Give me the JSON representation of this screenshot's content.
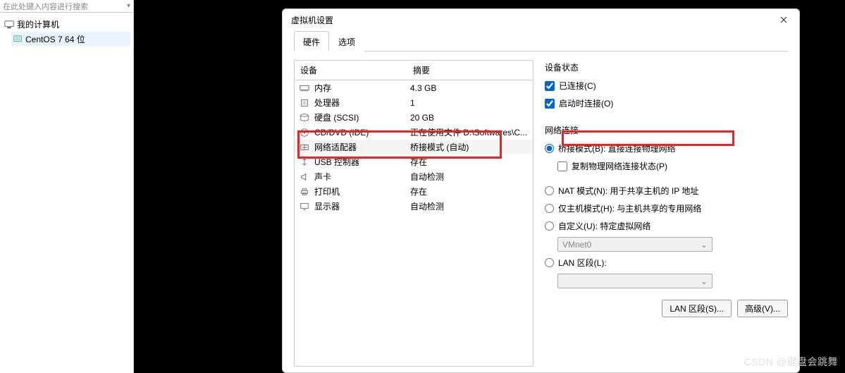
{
  "left": {
    "search_placeholder": "在此处键入内容进行搜索",
    "root_label": "我的计算机",
    "vm_label": "CentOS 7 64 位"
  },
  "dialog": {
    "title": "虚拟机设置",
    "tabs": {
      "hardware": "硬件",
      "options": "选项"
    },
    "columns": {
      "device": "设备",
      "summary": "摘要"
    },
    "hardware": [
      {
        "icon": "memory-icon",
        "name": "内存",
        "summary": "4.3 GB"
      },
      {
        "icon": "cpu-icon",
        "name": "处理器",
        "summary": "1"
      },
      {
        "icon": "disk-icon",
        "name": "硬盘 (SCSI)",
        "summary": "20 GB"
      },
      {
        "icon": "cd-icon",
        "name": "CD/DVD (IDE)",
        "summary": "正在使用文件 D:\\Softwares\\C..."
      },
      {
        "icon": "nic-icon",
        "name": "网络适配器",
        "summary": "桥接模式 (自动)",
        "highlight": true
      },
      {
        "icon": "usb-icon",
        "name": "USB 控制器",
        "summary": "存在"
      },
      {
        "icon": "sound-icon",
        "name": "声卡",
        "summary": "自动检测"
      },
      {
        "icon": "printer-icon",
        "name": "打印机",
        "summary": "存在"
      },
      {
        "icon": "display-icon",
        "name": "显示器",
        "summary": "自动检测"
      }
    ],
    "status": {
      "title": "设备状态",
      "connected": "已连接(C)",
      "connect_at_power_on": "启动时连接(O)"
    },
    "network": {
      "title": "网络连接",
      "bridged": "桥接模式(B): 直接连接物理网络",
      "replicate": "复制物理网络连接状态(P)",
      "nat": "NAT 模式(N): 用于共享主机的 IP 地址",
      "hostonly": "仅主机模式(H): 与主机共享的专用网络",
      "custom": "自定义(U): 特定虚拟网络",
      "custom_value": "VMnet0",
      "lan": "LAN 区段(L):",
      "lan_value": ""
    },
    "buttons": {
      "lan_segments": "LAN 区段(S)...",
      "advanced": "高级(V)..."
    }
  },
  "watermark": "CSDN @键盘会跳舞"
}
